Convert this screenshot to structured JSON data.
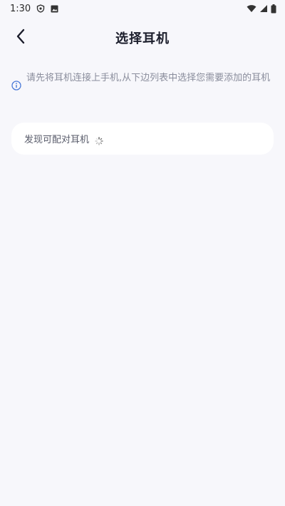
{
  "status_bar": {
    "time": "1:30",
    "icons": [
      "shield-icon",
      "image-icon",
      "wifi-icon",
      "signal-icon",
      "battery-icon"
    ]
  },
  "header": {
    "title": "选择耳机",
    "back_icon": "chevron-left-icon"
  },
  "hint": {
    "icon": "info-icon",
    "text": "请先将耳机连接上手机,从下边列表中选择您需要添加的耳机"
  },
  "discover": {
    "label": "发现可配对耳机",
    "status_icon": "loading-spinner-icon"
  },
  "colors": {
    "background": "#f7f7fb",
    "card": "#ffffff",
    "info_accent": "#4a7ad8",
    "hint_text": "#8a8d9c"
  }
}
